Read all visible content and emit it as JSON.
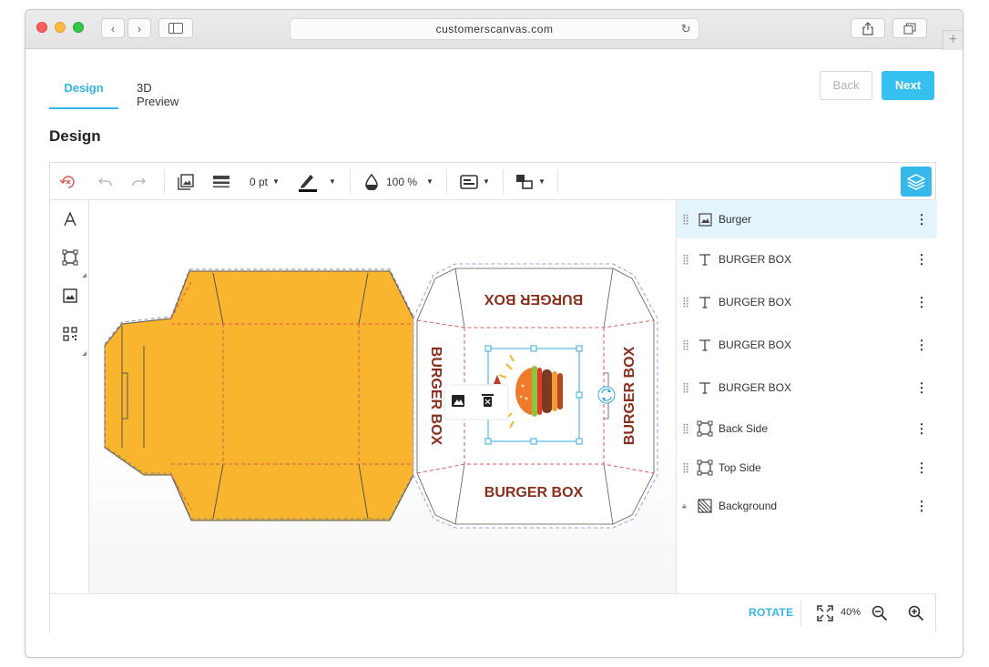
{
  "browser": {
    "url": "customerscanvas.com",
    "new_tab_symbol": "+"
  },
  "tabs": [
    {
      "label": "Design",
      "active": true
    },
    {
      "label": "3D Preview",
      "active": false
    }
  ],
  "nav": {
    "back_label": "Back",
    "next_label": "Next"
  },
  "page_title": "Design",
  "toolbar": {
    "stroke_width": "0 pt",
    "opacity": "100 %"
  },
  "canvas": {
    "top_text": "BURGER BOX",
    "bottom_text": "BURGER BOX",
    "left_text": "BURGER BOX",
    "right_text": "BURGER BOX",
    "box_color": "#f8b52d",
    "text_color": "#8b2f1c"
  },
  "layers": [
    {
      "name": "Burger",
      "icon": "image-icon",
      "selected": true
    },
    {
      "name": "BURGER BOX",
      "icon": "text-icon",
      "selected": false
    },
    {
      "name": "BURGER BOX",
      "icon": "text-icon",
      "selected": false
    },
    {
      "name": "BURGER BOX",
      "icon": "text-icon",
      "selected": false
    },
    {
      "name": "BURGER BOX",
      "icon": "text-icon",
      "selected": false
    },
    {
      "name": "Back Side",
      "icon": "shape-icon",
      "selected": false
    },
    {
      "name": "Top Side",
      "icon": "shape-icon",
      "selected": false
    },
    {
      "name": "Background",
      "icon": "background-icon",
      "selected": false,
      "locked": true
    }
  ],
  "footer": {
    "rotate_label": "ROTATE",
    "zoom": "40%"
  },
  "colors": {
    "accent": "#36c0f0",
    "selection": "#e3f4fc"
  }
}
